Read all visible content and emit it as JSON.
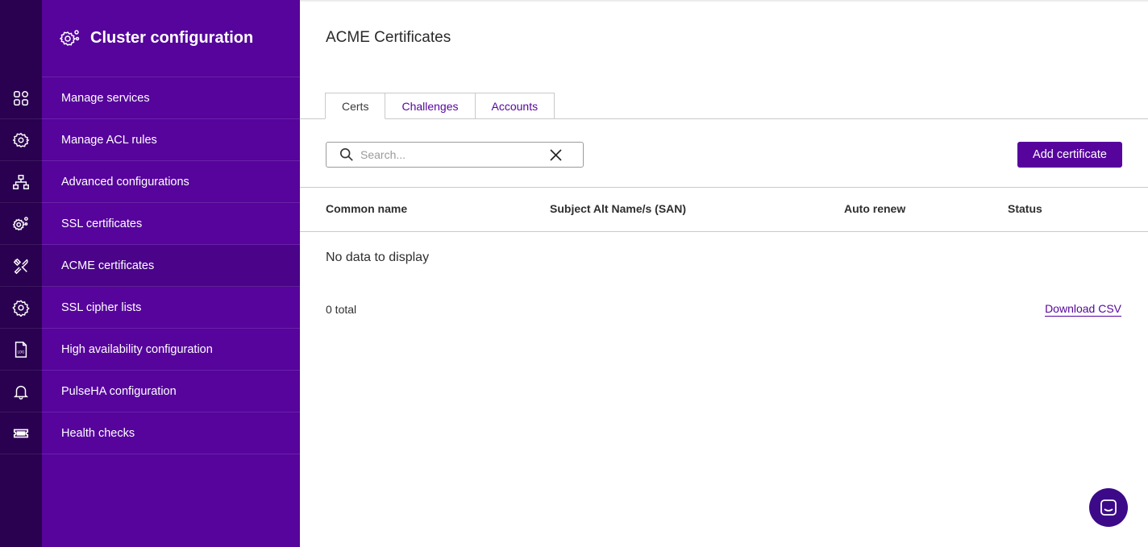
{
  "sidebar": {
    "title": "Cluster configuration",
    "items": [
      {
        "label": "Manage services",
        "icon": "grid-icon"
      },
      {
        "label": "Manage ACL rules",
        "icon": "gear-network-icon"
      },
      {
        "label": "Advanced configurations",
        "icon": "sitemap-icon"
      },
      {
        "label": "SSL certificates",
        "icon": "gears-icon"
      },
      {
        "label": "ACME certificates",
        "icon": "tools-icon",
        "active": true
      },
      {
        "label": "SSL cipher lists",
        "icon": "gear-icon"
      },
      {
        "label": "High availability configuration",
        "icon": "log-file-icon"
      },
      {
        "label": "PulseHA configuration",
        "icon": "bell-icon"
      },
      {
        "label": "Health checks",
        "icon": "ticket-icon"
      }
    ]
  },
  "main": {
    "title": "ACME Certificates",
    "tabs": [
      {
        "label": "Certs",
        "active": true
      },
      {
        "label": "Challenges"
      },
      {
        "label": "Accounts"
      }
    ],
    "search": {
      "placeholder": "Search...",
      "value": ""
    },
    "add_button": "Add certificate",
    "table": {
      "columns": [
        "Common name",
        "Subject Alt Name/s (SAN)",
        "Auto renew",
        "Status"
      ],
      "rows": [],
      "empty_text": "No data to display"
    },
    "total_text": "0 total",
    "download_label": "Download CSV"
  },
  "colors": {
    "rail": "#2a0150",
    "sidebar": "#56049c",
    "sidebar_active": "#4a0389",
    "accent": "#56049c",
    "chat": "#3c0a88"
  }
}
